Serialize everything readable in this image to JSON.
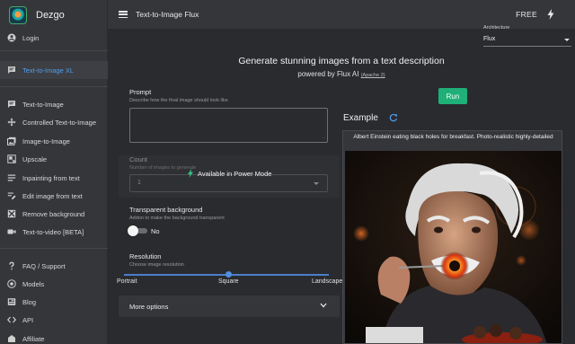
{
  "brand": {
    "name": "Dezgo"
  },
  "sidebar": {
    "items": [
      {
        "label": "Login",
        "icon": "account-circle-icon"
      },
      {
        "label": "Text-to-Image XL",
        "icon": "message-icon",
        "active": true
      },
      {
        "label": "Text-to-Image",
        "icon": "message-icon"
      },
      {
        "label": "Controlled Text-to-Image",
        "icon": "move-icon"
      },
      {
        "label": "Image-to-Image",
        "icon": "images-icon"
      },
      {
        "label": "Upscale",
        "icon": "upscale-icon"
      },
      {
        "label": "Inpainting from text",
        "icon": "inpaint-icon"
      },
      {
        "label": "Edit image from text",
        "icon": "edit-icon"
      },
      {
        "label": "Remove background",
        "icon": "remove-bg-icon"
      },
      {
        "label": "Text-to-video [BETA]",
        "icon": "video-icon"
      },
      {
        "label": "FAQ / Support",
        "icon": "question-icon"
      },
      {
        "label": "Models",
        "icon": "models-icon"
      },
      {
        "label": "Blog",
        "icon": "blog-icon"
      },
      {
        "label": "API",
        "icon": "code-icon"
      },
      {
        "label": "Affiliate",
        "icon": "affiliate-icon"
      }
    ]
  },
  "topbar": {
    "title": "Text-to-Image Flux",
    "plan": "FREE"
  },
  "architecture": {
    "label": "Architecture",
    "value": "Flux"
  },
  "hero": {
    "headline": "Generate stunning images from a text description",
    "powered_prefix": "powered by Flux AI",
    "license": "(Apache 2)"
  },
  "prompt": {
    "label": "Prompt",
    "hint": "Describe how the final image should look like",
    "value": ""
  },
  "run_button": {
    "label": "Run"
  },
  "count": {
    "label": "Count",
    "hint": "Number of images to generate",
    "value": "1",
    "lock_message": "Available in Power Mode"
  },
  "transparent": {
    "label": "Transparent background",
    "hint": "Addon to make the background transparent",
    "toggle_label": "No",
    "enabled": false
  },
  "resolution": {
    "label": "Resolution",
    "hint": "Choose image resolution",
    "options": [
      "Portrait",
      "Square",
      "Landscape"
    ],
    "selected": "Square"
  },
  "more_options": {
    "label": "More options"
  },
  "example": {
    "label": "Example",
    "caption": "Albert Einstein eating black holes for breakfast. Photo-realistic highly-detailed"
  },
  "colors": {
    "accent": "#4f9ff0",
    "run": "#1fb077",
    "background": "#2a2b2f",
    "panel": "#35363a"
  }
}
